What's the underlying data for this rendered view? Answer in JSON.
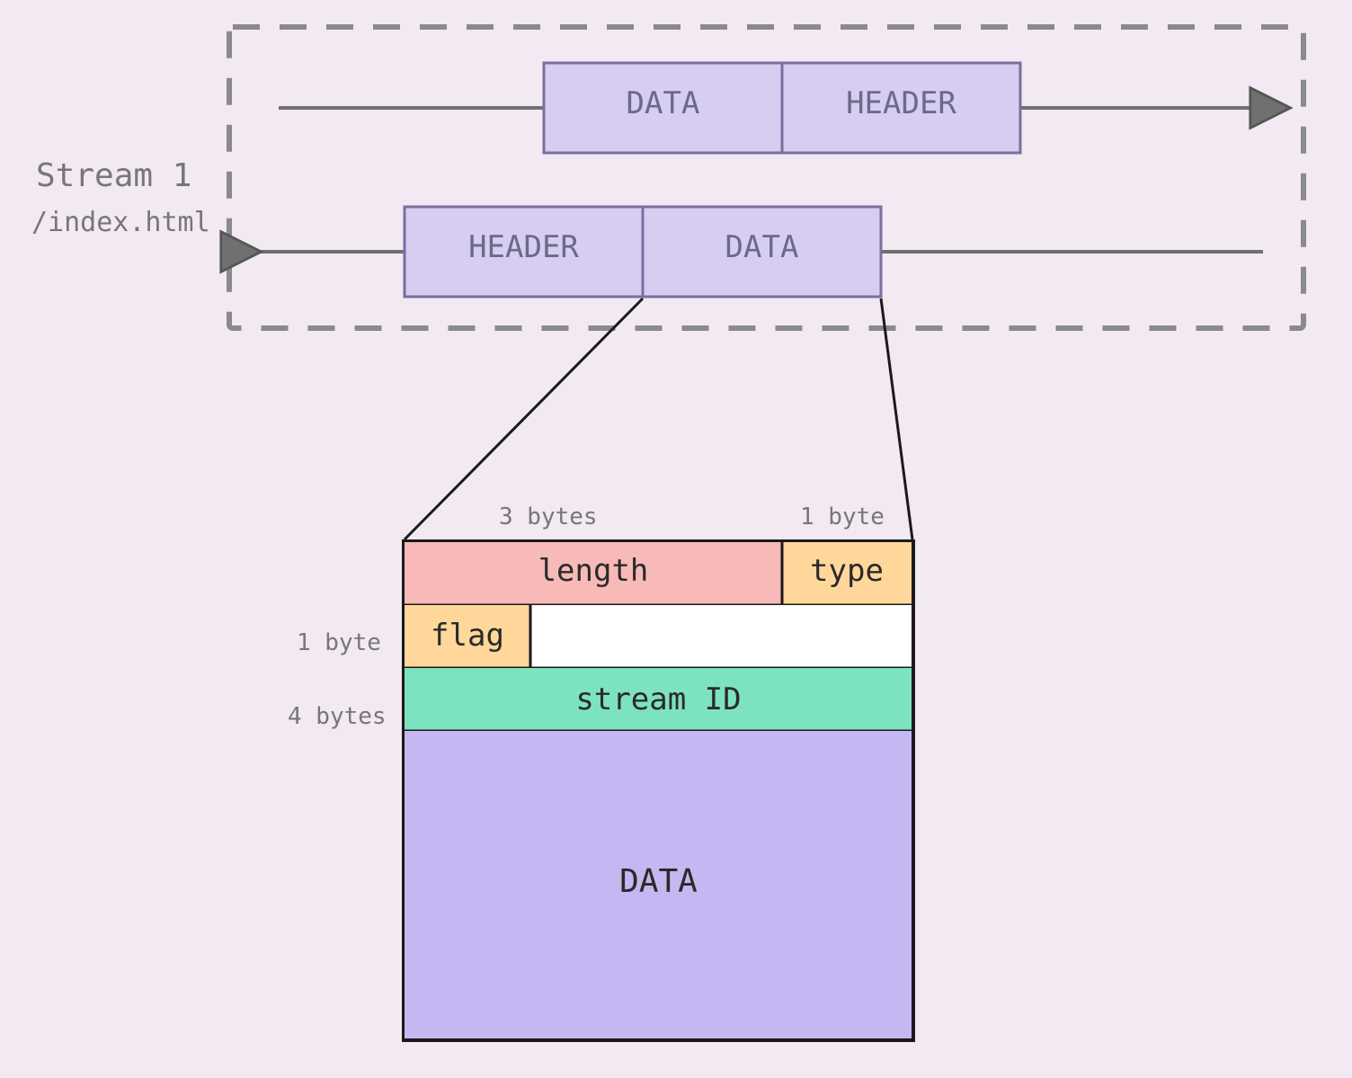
{
  "stream": {
    "title": "Stream 1",
    "path": "/index.html",
    "request": {
      "left": "DATA",
      "right": "HEADER"
    },
    "response": {
      "left": "HEADER",
      "right": "DATA"
    }
  },
  "frame": {
    "sizes": {
      "length": "3 bytes",
      "type": "1 byte",
      "flag": "1 byte",
      "stream_id": "4 bytes"
    },
    "fields": {
      "length": "length",
      "type": "type",
      "flag": "flag",
      "stream_id": "stream ID",
      "data": "DATA"
    }
  },
  "colors": {
    "box_fill": "#d7cdf0",
    "box_stroke": "#7a6fa0",
    "dash_stroke": "#8a8a8a",
    "arrow": "#707070",
    "pink": "#f8b9b9",
    "orange": "#ffd79a",
    "teal": "#7ce3be",
    "purple": "#c6b7f2",
    "black": "#1a1a1a"
  }
}
